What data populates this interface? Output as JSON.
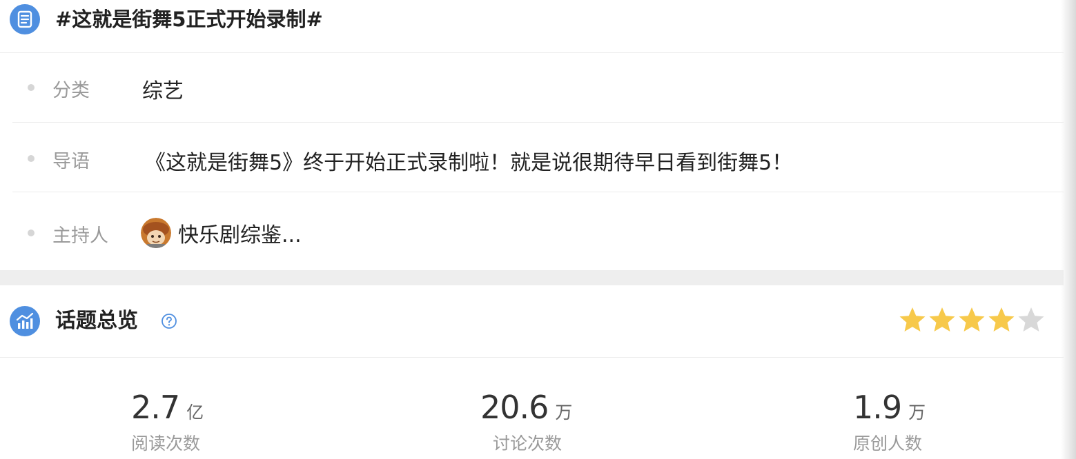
{
  "topic": {
    "title": "#这就是街舞5正式开始录制#",
    "rows": [
      {
        "label": "分类",
        "value": "综艺"
      },
      {
        "label": "导语",
        "value": "《这就是街舞5》终于开始正式录制啦！就是说很期待早日看到街舞5！"
      },
      {
        "label": "主持人",
        "value": "快乐剧综鉴..."
      }
    ]
  },
  "overview": {
    "title": "话题总览",
    "rating": 4,
    "rating_max": 5,
    "stats": [
      {
        "value": "2.7",
        "unit": "亿",
        "label": "阅读次数"
      },
      {
        "value": "20.6",
        "unit": "万",
        "label": "讨论次数"
      },
      {
        "value": "1.9",
        "unit": "万",
        "label": "原创人数"
      }
    ]
  },
  "colors": {
    "accent": "#4f8fe0",
    "star_on": "#f7c94b",
    "star_off": "#d8d8d8"
  }
}
